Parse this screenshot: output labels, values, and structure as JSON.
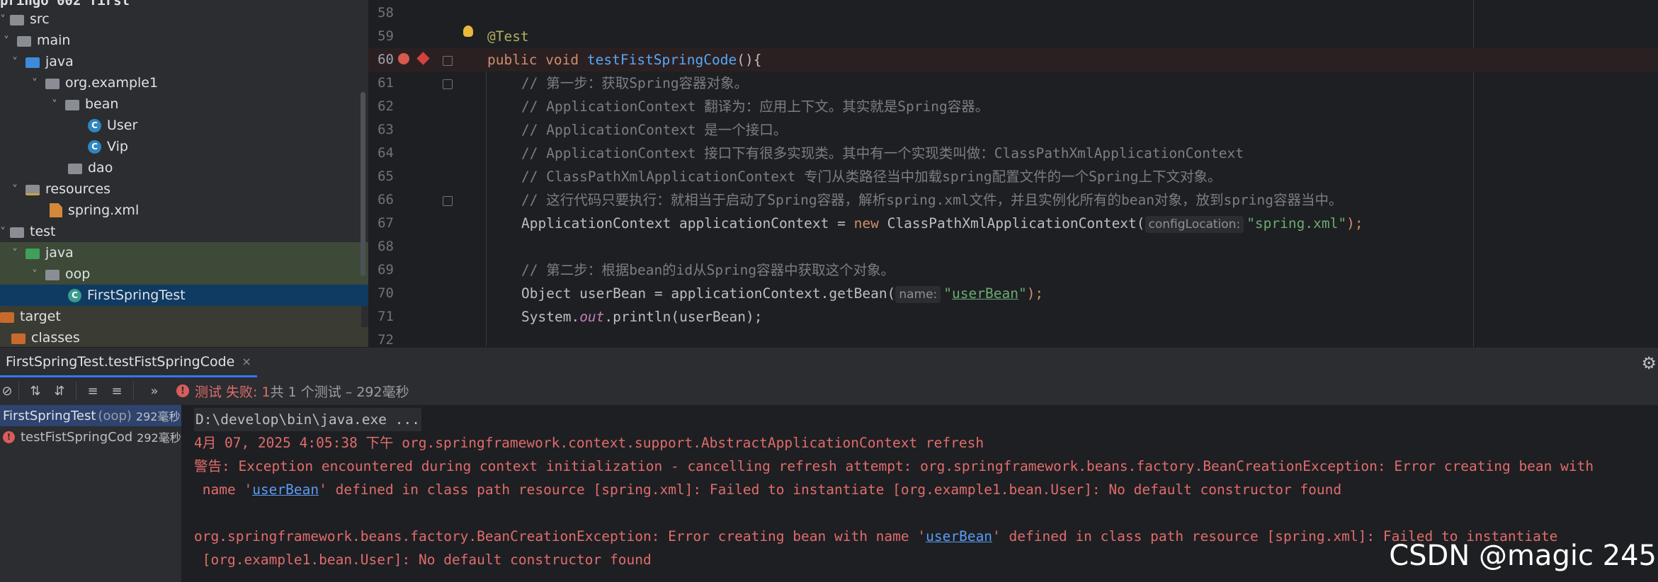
{
  "project_tree": {
    "header_fragment": "pringo 002 first",
    "items": [
      {
        "label": "src",
        "chevron": "",
        "icon": "folder"
      },
      {
        "label": "main",
        "chevron": "˅",
        "icon": "folder"
      },
      {
        "label": "java",
        "chevron": "˅",
        "icon": "source-folder"
      },
      {
        "label": "org.example1",
        "chevron": "˅",
        "icon": "package"
      },
      {
        "label": "bean",
        "chevron": "˅",
        "icon": "package"
      },
      {
        "label": "User",
        "chevron": "",
        "icon": "class"
      },
      {
        "label": "Vip",
        "chevron": "",
        "icon": "class"
      },
      {
        "label": "dao",
        "chevron": "",
        "icon": "package"
      },
      {
        "label": "resources",
        "chevron": "˅",
        "icon": "resources-folder"
      },
      {
        "label": "spring.xml",
        "chevron": "",
        "icon": "xml-file"
      },
      {
        "label": "test",
        "chevron": "˅",
        "icon": "folder"
      },
      {
        "label": "java",
        "chevron": "˅",
        "icon": "test-folder"
      },
      {
        "label": "oop",
        "chevron": "˅",
        "icon": "package"
      },
      {
        "label": "FirstSpringTest",
        "chevron": "",
        "icon": "test-class"
      },
      {
        "label": "target",
        "chevron": "",
        "icon": "excluded-folder"
      },
      {
        "label": "classes",
        "chevron": "",
        "icon": "excluded-folder"
      }
    ]
  },
  "editor": {
    "line_numbers": [
      "58",
      "59",
      "60",
      "61",
      "62",
      "63",
      "64",
      "65",
      "66",
      "67",
      "68",
      "69",
      "70",
      "71",
      "72"
    ],
    "lines": {
      "l59": "@Test",
      "l60_kw": "public void ",
      "l60_fn": "testFistSpringCode",
      "l60_rest": "(){",
      "l61": "// 第一步：获取Spring容器对象。",
      "l62": "// ApplicationContext 翻译为：应用上下文。其实就是Spring容器。",
      "l63": "// ApplicationContext 是一个接口。",
      "l64": "// ApplicationContext 接口下有很多实现类。其中有一个实现类叫做：ClassPathXmlApplicationContext",
      "l65": "// ClassPathXmlApplicationContext 专门从类路径当中加载spring配置文件的一个Spring上下文对象。",
      "l66": "// 这行代码只要执行：就相当于启动了Spring容器，解析spring.xml文件，并且实例化所有的bean对象，放到spring容器当中。",
      "l67_a": "ApplicationContext applicationContext = ",
      "l67_new": "new",
      "l67_b": " ClassPathXmlApplicationContext(",
      "l67_hint": "configLocation:",
      "l67_str": "\"spring.xml\"",
      "l67_end": ");",
      "l69": "// 第二步：根据bean的id从Spring容器中获取这个对象。",
      "l70_a": "Object userBean = applicationContext.getBean(",
      "l70_hint": "name:",
      "l70_q1": "\"",
      "l70_str": "userBean",
      "l70_q2": "\"",
      "l70_end": ");",
      "l71_a": "System.",
      "l71_out": "out",
      "l71_b": ".println(userBean);"
    }
  },
  "run_panel": {
    "tab_label": "FirstSpringTest.testFistSpringCode",
    "tab_close": "×",
    "status_fail": "测试 失败: 1",
    "status_rest": "共 1 个测试 – 292毫秒",
    "results": [
      {
        "name": "FirstSpringTest",
        "group": "(oop)",
        "time": "292毫秒"
      },
      {
        "name": "testFistSpringCod",
        "group": "",
        "time": "292毫秒"
      }
    ],
    "console": {
      "cmd": "D:\\develop\\bin\\java.exe ...",
      "line2": "4月 07, 2025 4:05:38 下午 org.springframework.context.support.AbstractApplicationContext refresh",
      "line3": "警告: Exception encountered during context initialization - cancelling refresh attempt: org.springframework.beans.factory.BeanCreationException: Error creating bean with",
      "line4_a": " name '",
      "line4_link": "userBean",
      "line4_b": "' defined in class path resource [spring.xml]: Failed to instantiate [org.example1.bean.User]: No default constructor found",
      "line6_a": "org.springframework.beans.factory.BeanCreationException: Error creating bean with name '",
      "line6_link": "userBean",
      "line6_b": "' defined in class path resource [spring.xml]: Failed to instantiate",
      "line7": " [org.example1.bean.User]: No default constructor found"
    }
  },
  "watermark": "CSDN @magic 245"
}
